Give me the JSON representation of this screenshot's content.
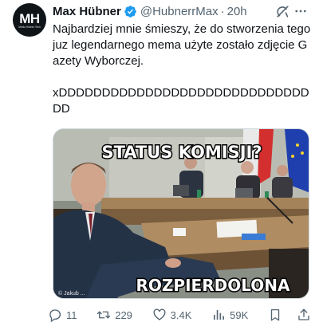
{
  "author": {
    "avatar_text": "MH",
    "avatar_subtext": "Media Hübner Tech",
    "name": "Max Hübner",
    "handle": "@HubnerrMax",
    "separator": "·",
    "time": "20h"
  },
  "tweet": {
    "text": "Najbardziej mnie śmieszy, że do stworzenia tego juz legendarnego mema użyte zostało zdjęcie Gazety Wyborczej.\n\nxDDDDDDDDDDDDDDDDDDDDDDDDDDDDDDD"
  },
  "media": {
    "caption_top": "STATUS KOMISJI?",
    "caption_bottom": "ROZPIERDOLONA",
    "watermark": "© Jakub ..."
  },
  "actions": {
    "replies": "11",
    "reposts": "229",
    "likes": "3.4K",
    "views": "59K"
  },
  "icons": {
    "verified": "verified-badge-icon",
    "grok": "grok-icon",
    "more": "more-icon",
    "reply": "reply-icon",
    "repost": "repost-icon",
    "like": "like-icon",
    "views": "views-icon",
    "bookmark": "bookmark-icon",
    "share": "share-icon"
  },
  "colors": {
    "verified_blue": "#1d9bf0",
    "text_primary": "#0f1419",
    "text_secondary": "#536471"
  }
}
